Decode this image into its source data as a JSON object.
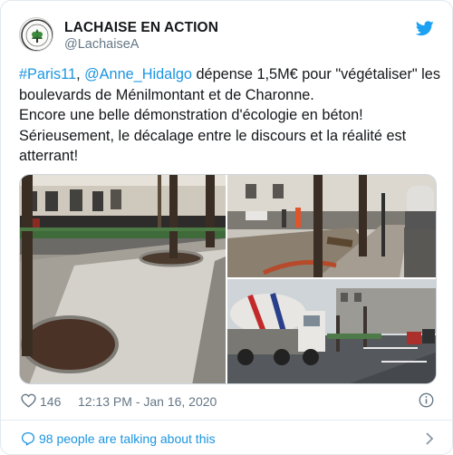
{
  "tweet": {
    "display_name": "LACHAISE EN ACTION",
    "handle": "@LachaiseA",
    "text_lines": [
      [
        {
          "t": "#Paris11",
          "link": true
        },
        {
          "t": ", ",
          "link": false
        },
        {
          "t": "@Anne_Hidalgo",
          "link": true
        },
        {
          "t": " dépense 1,5M€ pour \"végétaliser\" les",
          "link": false
        }
      ],
      [
        {
          "t": "boulevards de Ménilmontant et de Charonne.",
          "link": false
        }
      ],
      [
        {
          "t": "Encore une belle démonstration d'écologie en béton!",
          "link": false
        }
      ],
      [
        {
          "t": "Sérieusement, le décalage entre le discours et la réalité est",
          "link": false
        }
      ],
      [
        {
          "t": "atterrant!",
          "link": false
        }
      ]
    ],
    "likes": "146",
    "timestamp": "12:13 PM - Jan 16, 2020",
    "talking": "98 people are talking about this"
  },
  "icons": {
    "avatar": "avatar-logo",
    "brand": "twitter-bird-icon",
    "like": "heart-icon",
    "info": "info-icon",
    "talking": "speech-bubble-icon",
    "chevron": "chevron-right-icon"
  },
  "colors": {
    "link": "#1b95e0",
    "text": "#14171a",
    "muted": "#657786",
    "border": "#e1e8ed"
  }
}
